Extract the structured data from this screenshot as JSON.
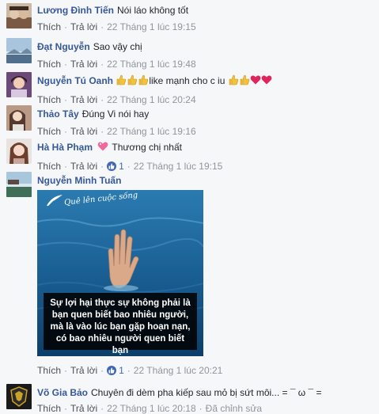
{
  "reply_label": "Thích",
  "reply2_label": "Trả lời",
  "comments": [
    {
      "name": "Lương Đình Tiến",
      "text": "Nói láo không tốt",
      "time": "22 Tháng 1 lúc 19:15"
    },
    {
      "name": "Đạt Nguyễn",
      "text": "Sao vậy chị",
      "time": "22 Tháng 1 lúc 19:48"
    },
    {
      "name": "Nguyễn Tú Oanh",
      "text": "like mạnh cho c iu",
      "time": "22 Tháng 1 lúc 20:24"
    },
    {
      "name": "Thảo Tây",
      "text": "Đúng Vi nói hay",
      "time": "22 Tháng 1 lúc 19:16"
    },
    {
      "name": "Hà Hà Phạm",
      "text": "Thương chị nhất",
      "time": "22 Tháng 1 lúc 19:15",
      "likes": "1"
    },
    {
      "name": "Nguyễn Minh Tuấn",
      "text": "",
      "time": "22 Tháng 1 lúc 20:21",
      "likes": "1"
    },
    {
      "name": "Võ Gia Bảo",
      "text": "Chuyên đi dèm pha kiếp sau mỏ bị sứt môi... = ¯ ω ¯ =",
      "time": "22 Tháng 1 lúc 20:18",
      "edited": "Đã chỉnh sửa"
    }
  ],
  "photo": {
    "watermark": "Quê lên cuộc sống",
    "caption": "Sự lợi hại thực sự không phải là bạn quen biết bao nhiêu người, mà là vào lúc bạn gặp hoạn nạn, có bao nhiêu người quen biết bạn"
  },
  "colors": {
    "name": "#365899",
    "like": "#4267b2",
    "meta": "#90949c",
    "bg": "#f6f7f9"
  }
}
